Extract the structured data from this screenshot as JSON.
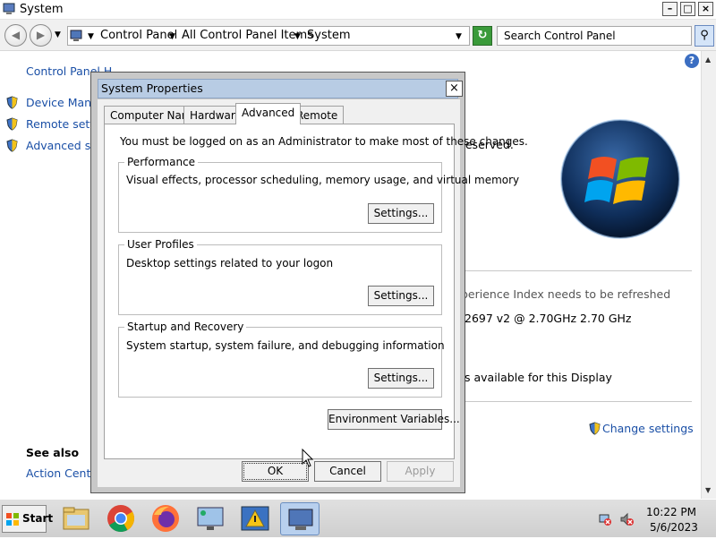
{
  "window": {
    "title": "System"
  },
  "address": {
    "crumbs": [
      "Control Panel",
      "All Control Panel Items",
      "System"
    ]
  },
  "search": {
    "placeholder": "Search Control Panel"
  },
  "left_pane": {
    "home_link": "Control Panel H",
    "links": [
      "Device Manag",
      "Remote settin",
      "Advanced sys"
    ],
    "see_also_heading": "See also",
    "see_also_links": [
      "Action Center"
    ]
  },
  "main": {
    "copyright": "reserved.",
    "rating": "perience Index needs to be refreshed",
    "processor": "2697 v2 @ 2.70GHz   2.70 GHz",
    "pen_touch": "s available for this Display",
    "change_settings": "Change settings"
  },
  "dialog": {
    "title": "System Properties",
    "tabs": [
      "Computer Name",
      "Hardware",
      "Advanced",
      "Remote"
    ],
    "active_tab": "Advanced",
    "admin_note": "You must be logged on as an Administrator to make most of these changes.",
    "performance": {
      "label": "Performance",
      "desc": "Visual effects, processor scheduling, memory usage, and virtual memory",
      "button": "Settings..."
    },
    "user_profiles": {
      "label": "User Profiles",
      "desc": "Desktop settings related to your logon",
      "button": "Settings..."
    },
    "startup": {
      "label": "Startup and Recovery",
      "desc": "System startup, system failure, and debugging information",
      "button": "Settings..."
    },
    "env_button": "Environment Variables...",
    "ok": "OK",
    "cancel": "Cancel",
    "apply": "Apply"
  },
  "taskbar": {
    "start": "Start",
    "time": "10:22 PM",
    "date": "5/6/2023"
  },
  "colors": {
    "link": "#1a4fa6",
    "dialog_title_bg": "#b8cce4",
    "taskbar_active": "#b8d0ee"
  }
}
